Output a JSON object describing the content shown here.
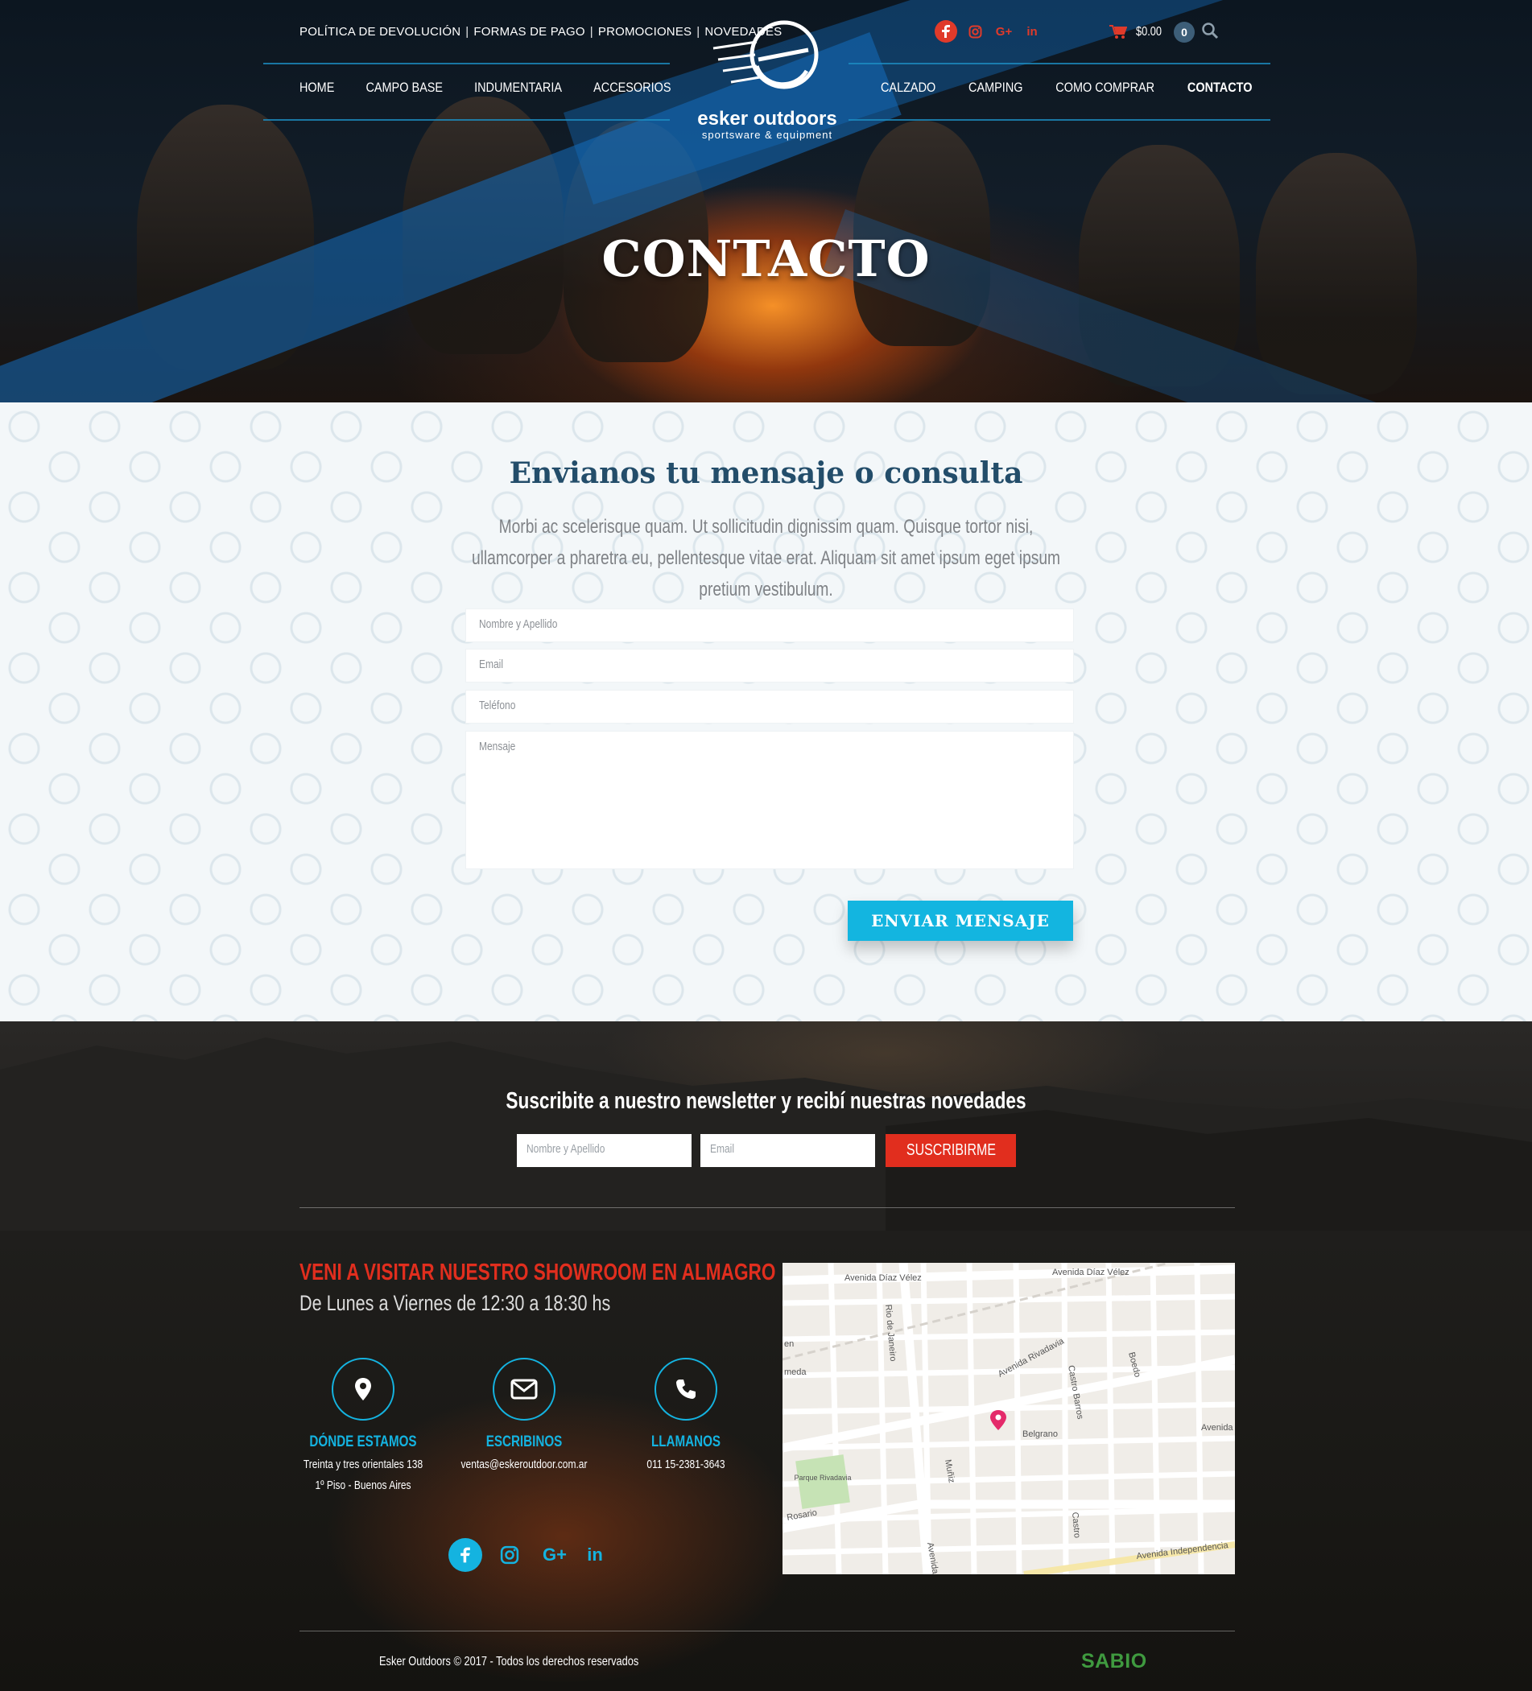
{
  "header": {
    "top_links": [
      "POLÍTICA DE DEVOLUCIÓN",
      "FORMAS DE PAGO",
      "PROMOCIONES",
      "NOVEDADES"
    ],
    "nav_left": [
      "HOME",
      "CAMPO BASE",
      "INDUMENTARIA",
      "ACCESORIOS"
    ],
    "nav_right": [
      "CALZADO",
      "CAMPING",
      "COMO COMPRAR",
      "CONTACTO"
    ],
    "logo": {
      "name": "esker outdoors",
      "tagline": "sportsware & equipment"
    },
    "social": [
      "facebook-icon",
      "instagram-icon",
      "google-plus-icon",
      "linkedin-icon"
    ],
    "social_labels": {
      "gplus": "G+",
      "linkedin": "in"
    },
    "cart": {
      "total": "$0.00",
      "count": "0"
    },
    "accent_color": "#e03a2a"
  },
  "hero": {
    "title": "CONTACTO"
  },
  "contact": {
    "title": "Envianos tu mensaje o consulta",
    "text": "Morbi ac scelerisque quam. Ut sollicitudin dignissim quam. Quisque tortor nisi, ullamcorper a pharetra eu, pellentesque vitae erat. Aliquam sit amet ipsum eget ipsum pretium vestibulum.",
    "fields": {
      "name": "Nombre y Apellido",
      "email": "Email",
      "phone": "Teléfono",
      "message": "Mensaje"
    },
    "submit": "ENVIAR MENSAJE",
    "button_color": "#13b5e0",
    "title_color": "#234d6a"
  },
  "newsletter": {
    "title": "Suscribite a nuestro newsletter y recibí nuestras novedades",
    "name_placeholder": "Nombre y Apellido",
    "email_placeholder": "Email",
    "button": "SUSCRIBIRME",
    "button_color": "#e12e1e"
  },
  "showroom": {
    "title": "VENI A VISITAR NUESTRO SHOWROOM EN ALMAGRO",
    "hours": "De Lunes a Viernes de 12:30 a 18:30 hs"
  },
  "info": {
    "location": {
      "title": "DÓNDE ESTAMOS",
      "line1": "Treinta y tres orientales 138",
      "line2": "1º Piso - Buenos Aires",
      "icon": "map-pin-icon"
    },
    "mail": {
      "title": "ESCRIBINOS",
      "line1": "ventas@eskeroutdoor.com.ar",
      "icon": "envelope-icon"
    },
    "phone": {
      "title": "LLAMANOS",
      "line1": "011 15-2381-3643",
      "icon": "phone-icon"
    }
  },
  "map": {
    "streets": [
      "Avenida Díaz Vélez",
      "Avenida Díaz Vélez",
      "Rio de Janeiro",
      "Avenida Rivadavia",
      "Castro Barros",
      "Boedo",
      "Belgrano",
      "Avenida",
      "Muñiz",
      "Rosario",
      "Avenida",
      "Castro",
      "Avenida Independencia",
      "Parque Rivadavia",
      "en",
      "meda"
    ]
  },
  "footer": {
    "copyright": "Esker Outdoors © 2017 - Todos los derechos reservados",
    "credit": "SABIO",
    "credit_color": "#3f9a3f"
  }
}
